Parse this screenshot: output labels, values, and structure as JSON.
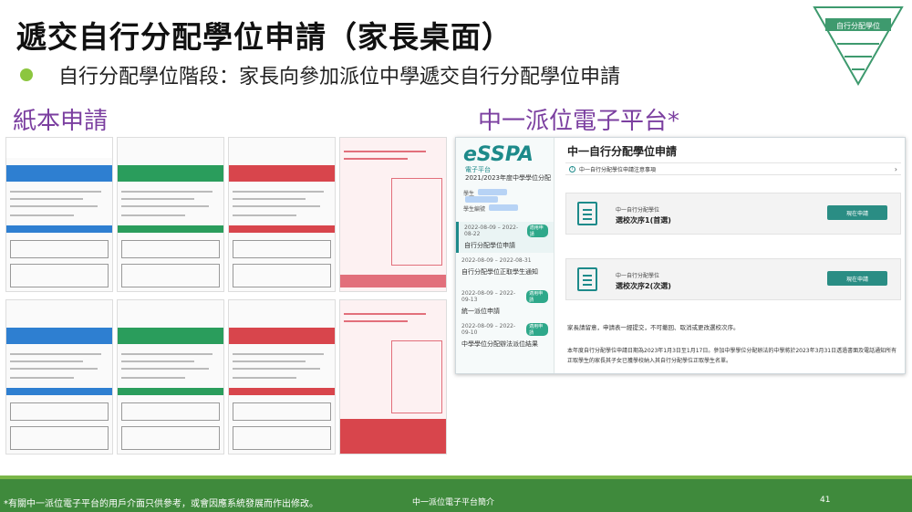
{
  "title": "遞交自行分配學位申請（家長桌面）",
  "bullet": "自行分配學位階段：家長向參加派位中學遞交自行分配學位申請",
  "pyramid_label": "自行分配學位",
  "paper_section": "紙本申請",
  "esspa_section": "中一派位電子平台*",
  "colors": {
    "accent_green": "#8cc63f",
    "heading_purple": "#7b3fa0",
    "essp_teal": "#1d8a8a",
    "footer_green": "#3f8a3c",
    "form_blue": "#2e7fd1",
    "form_green": "#2a9d5c",
    "form_red": "#d8454c",
    "form_pink": "#e26f7b"
  },
  "esspa": {
    "logo": "eSSPA",
    "logo_sub": "電子平台",
    "year": "2021/2023年度中學學位分配",
    "student_label_1": "學生",
    "student_label_2": "學生編號",
    "events": [
      {
        "date": "2022-08-09 – 2022-08-22",
        "badge": "適用申請",
        "title": "自行分配學位申請",
        "active": true
      },
      {
        "date": "2022-08-09 – 2022-08-31",
        "badge": "",
        "title": "自行分配學位正取學生通知",
        "active": false
      },
      {
        "date": "2022-08-09 – 2022-09-13",
        "badge": "適用申請",
        "title": "統一派位申請",
        "active": false
      },
      {
        "date": "2022-08-09 – 2022-09-10",
        "badge": "適用申請",
        "title": "中學學位分配辦法派位結果",
        "active": false
      }
    ],
    "main_title": "中一自行分配學位申請",
    "info_text": "中一自行分配學位申請注意事項",
    "cards": [
      {
        "sub": "中一自行分配學位",
        "main": "選校次序1(首選)",
        "button": "現在申請"
      },
      {
        "sub": "中一自行分配學位",
        "main": "選校次序2(次選)",
        "button": "現在申請"
      }
    ],
    "notice1": "家長請留意，申請表一經提交，不可撤回、取消或更改選校次序。",
    "notice2": "本年度自行分配學位申請日期為2023年1月3日至1月17日。參加中學學位分配辦法的中學將於2023年3月31日透過書面及電話通知所有正取學生的家長其子女已獲學校納入其自行分配學位正取學生名單。"
  },
  "footer": {
    "note": "*有關中一派位電子平台的用戶介面只供參考，或會因應系統發展而作出修改。",
    "center": "中一派位電子平台簡介",
    "page": "41"
  }
}
